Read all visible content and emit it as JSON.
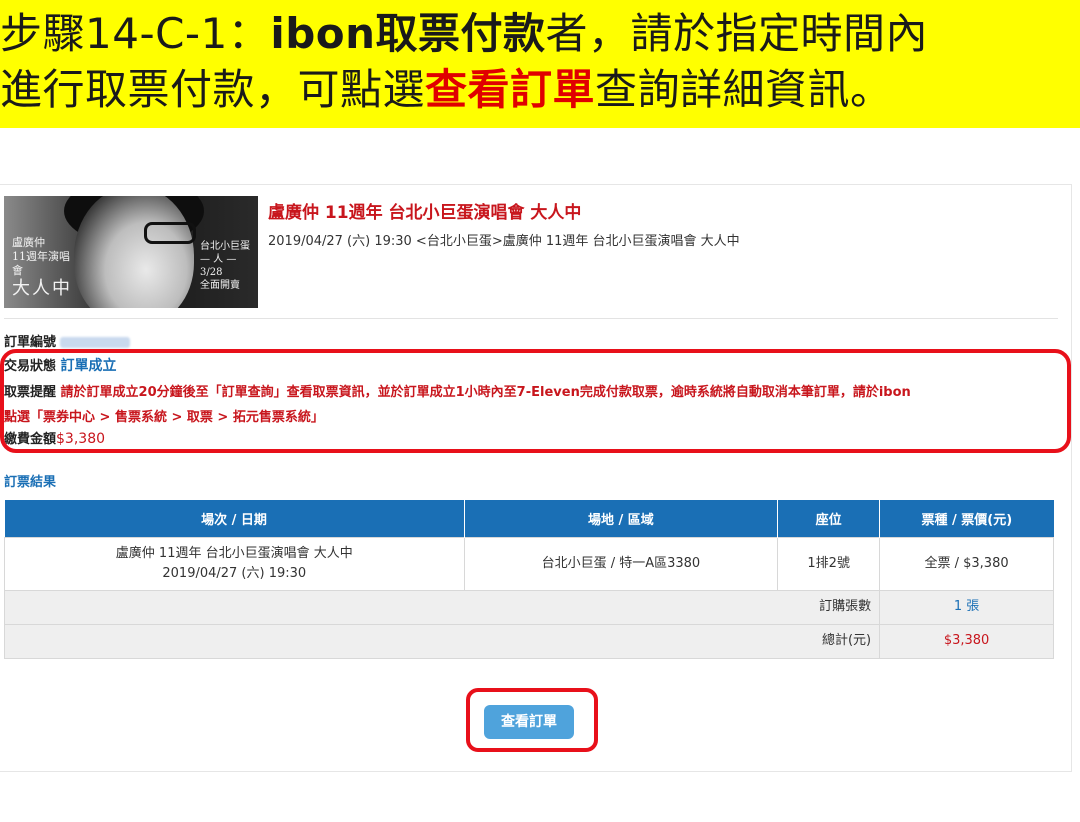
{
  "banner": {
    "line1_prefix": "步驟14-C-1：",
    "line1_bold": "ibon取票付款",
    "line1_suffix": "者，請於指定時間內",
    "line2_prefix": "進行取票付款，可點選",
    "line2_red": "查看訂單",
    "line2_suffix": "查詢詳細資訊。"
  },
  "poster": {
    "left_small1": "盧廣仲",
    "left_small2": "11週年演唱會",
    "left_big": "大人中",
    "right_line1": "台北小巨蛋",
    "right_line2": "— 人 —",
    "right_line3": "3/28",
    "right_line4": "全面開賣"
  },
  "event": {
    "title": "盧廣仲 11週年 台北小巨蛋演唱會 大人中",
    "subtitle": "2019/04/27 (六) 19:30 <台北小巨蛋>盧廣仲 11週年 台北小巨蛋演唱會 大人中"
  },
  "order": {
    "number_label": "訂單編號",
    "status_label": "交易狀態",
    "status_value": "訂單成立",
    "reminder_label": "取票提醒",
    "reminder_line1": "請於訂單成立20分鐘後至「訂單查詢」查看取票資訊，並於訂單成立1小時內至7-Eleven完成付款取票，逾時系統將自動取消本筆訂單，請於ibon",
    "reminder_line2": "點選「票券中心 > 售票系統 > 取票 > 拓元售票系統」",
    "fee_label": "繳費金額",
    "fee_value": "$3,380"
  },
  "result": {
    "heading": "訂票結果",
    "columns": [
      "場次 / 日期",
      "場地 / 區域",
      "座位",
      "票種 / 票價(元)"
    ],
    "row": {
      "event_line1": "盧廣仲 11週年 台北小巨蛋演唱會 大人中",
      "event_line2": "2019/04/27 (六) 19:30",
      "venue": "台北小巨蛋 / 特一A區3380",
      "seat": "1排2號",
      "price": "全票 / $3,380"
    },
    "qty_label": "訂購張數",
    "qty_value": "1 張",
    "total_label": "總計(元)",
    "total_value": "$3,380"
  },
  "actions": {
    "view_order": "查看訂單"
  },
  "colors": {
    "banner_bg": "#ffff00",
    "accent_red": "#e8101a",
    "table_header": "#1a6fb5",
    "button": "#4fa3dc"
  }
}
